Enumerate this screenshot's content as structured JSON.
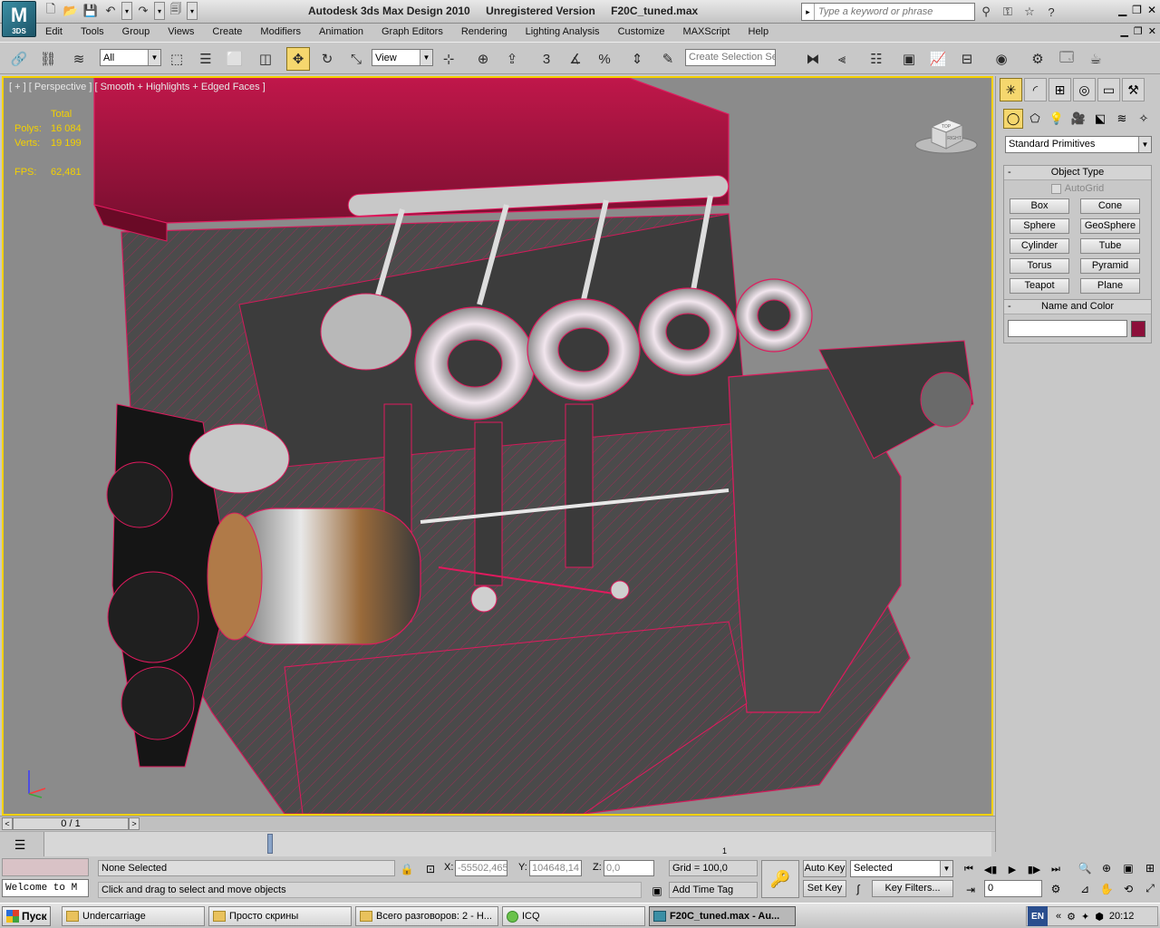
{
  "app": {
    "logo_text": "M",
    "logo_sub": "3DS",
    "title": "Autodesk 3ds Max Design 2010",
    "registration": "Unregistered Version",
    "filename": "F20C_tuned.max",
    "search_placeholder": "Type a keyword or phrase"
  },
  "menu": [
    "Edit",
    "Tools",
    "Group",
    "Views",
    "Create",
    "Modifiers",
    "Animation",
    "Graph Editors",
    "Rendering",
    "Lighting Analysis",
    "Customize",
    "MAXScript",
    "Help"
  ],
  "toolbar": {
    "filter_value": "All",
    "refcoord_value": "View",
    "snap_angle_label": "3",
    "selection_set_placeholder": "Create Selection Se"
  },
  "viewport": {
    "label": "[ + ] [ Perspective ] [ Smooth + Highlights + Edged Faces ]",
    "stats": {
      "total_label": "Total",
      "polys_label": "Polys:",
      "polys_value": "16 084",
      "verts_label": "Verts:",
      "verts_value": "19 199",
      "fps_label": "FPS:",
      "fps_value": "62,481"
    },
    "viewcube_labels": [
      "TOP",
      "RIGHT"
    ]
  },
  "command_panel": {
    "category": "Standard Primitives",
    "object_type_title": "Object Type",
    "autogrid_label": "AutoGrid",
    "primitives": [
      "Box",
      "Cone",
      "Sphere",
      "GeoSphere",
      "Cylinder",
      "Tube",
      "Torus",
      "Pyramid",
      "Teapot",
      "Plane"
    ],
    "name_color_title": "Name and Color",
    "name_value": "",
    "color": "#8c0f3a"
  },
  "time": {
    "slider_label": "0 / 1",
    "track_tick": "1"
  },
  "status": {
    "listener_text": "Welcome to M",
    "selection_text": "None Selected",
    "prompt_text": "Click and drag to select and move objects",
    "x_label": "X:",
    "x_value": "-55502,465",
    "y_label": "Y:",
    "y_value": "104648,14",
    "z_label": "Z:",
    "z_value": "0,0",
    "grid_text": "Grid = 100,0",
    "time_tag": "Add Time Tag",
    "auto_key": "Auto Key",
    "set_key": "Set Key",
    "key_mode_value": "Selected",
    "key_filters": "Key Filters...",
    "frame_value": "0"
  },
  "taskbar": {
    "start_label": "Пуск",
    "tasks": [
      "Undercarriage",
      "Просто скрины",
      "Всего разговоров: 2 - Н...",
      "ICQ",
      "F20C_tuned.max - Au..."
    ],
    "lang": "EN",
    "clock": "20:12"
  }
}
